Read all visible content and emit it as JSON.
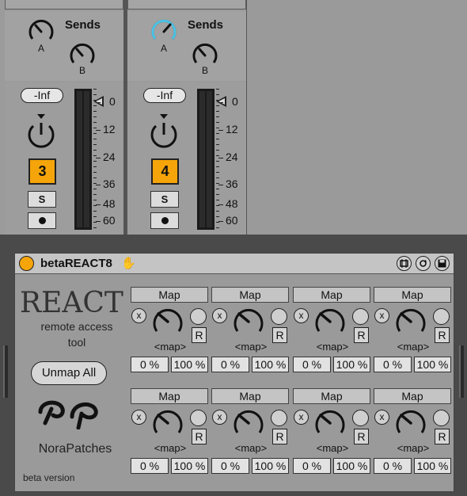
{
  "tracks": [
    {
      "sends_title": "Sends",
      "send_a": "A",
      "send_b": "B",
      "volume": "-Inf",
      "number": "3",
      "solo": "S",
      "send_a_active": false
    },
    {
      "sends_title": "Sends",
      "send_a": "A",
      "send_b": "B",
      "volume": "-Inf",
      "number": "4",
      "solo": "S",
      "send_a_active": true
    }
  ],
  "meter_scale": [
    "0",
    "12",
    "24",
    "36",
    "48",
    "60"
  ],
  "device": {
    "title": "betaREACT8",
    "logo": "REACT",
    "subtitle_1": "remote access",
    "subtitle_2": "tool",
    "unmap_all": "Unmap All",
    "author": "NoraPatches",
    "beta": "beta version",
    "icons": {
      "power": "power-icon",
      "hand": "hand-icon",
      "header": [
        "hot-swap-icon",
        "save-preset-icon",
        "save-icon"
      ]
    }
  },
  "slots": [
    {
      "map": "Map",
      "x": "x",
      "r": "R",
      "map_text": "<map>",
      "min": "0 %",
      "max": "100 %"
    },
    {
      "map": "Map",
      "x": "x",
      "r": "R",
      "map_text": "<map>",
      "min": "0 %",
      "max": "100 %"
    },
    {
      "map": "Map",
      "x": "x",
      "r": "R",
      "map_text": "<map>",
      "min": "0 %",
      "max": "100 %"
    },
    {
      "map": "Map",
      "x": "x",
      "r": "R",
      "map_text": "<map>",
      "min": "0 %",
      "max": "100 %"
    },
    {
      "map": "Map",
      "x": "x",
      "r": "R",
      "map_text": "<map>",
      "min": "0 %",
      "max": "100 %"
    },
    {
      "map": "Map",
      "x": "x",
      "r": "R",
      "map_text": "<map>",
      "min": "0 %",
      "max": "100 %"
    },
    {
      "map": "Map",
      "x": "x",
      "r": "R",
      "map_text": "<map>",
      "min": "0 %",
      "max": "100 %"
    },
    {
      "map": "Map",
      "x": "x",
      "r": "R",
      "map_text": "<map>",
      "min": "0 %",
      "max": "100 %"
    }
  ],
  "colors": {
    "accent": "#f5a50a",
    "active_knob": "#4cc3e6"
  }
}
